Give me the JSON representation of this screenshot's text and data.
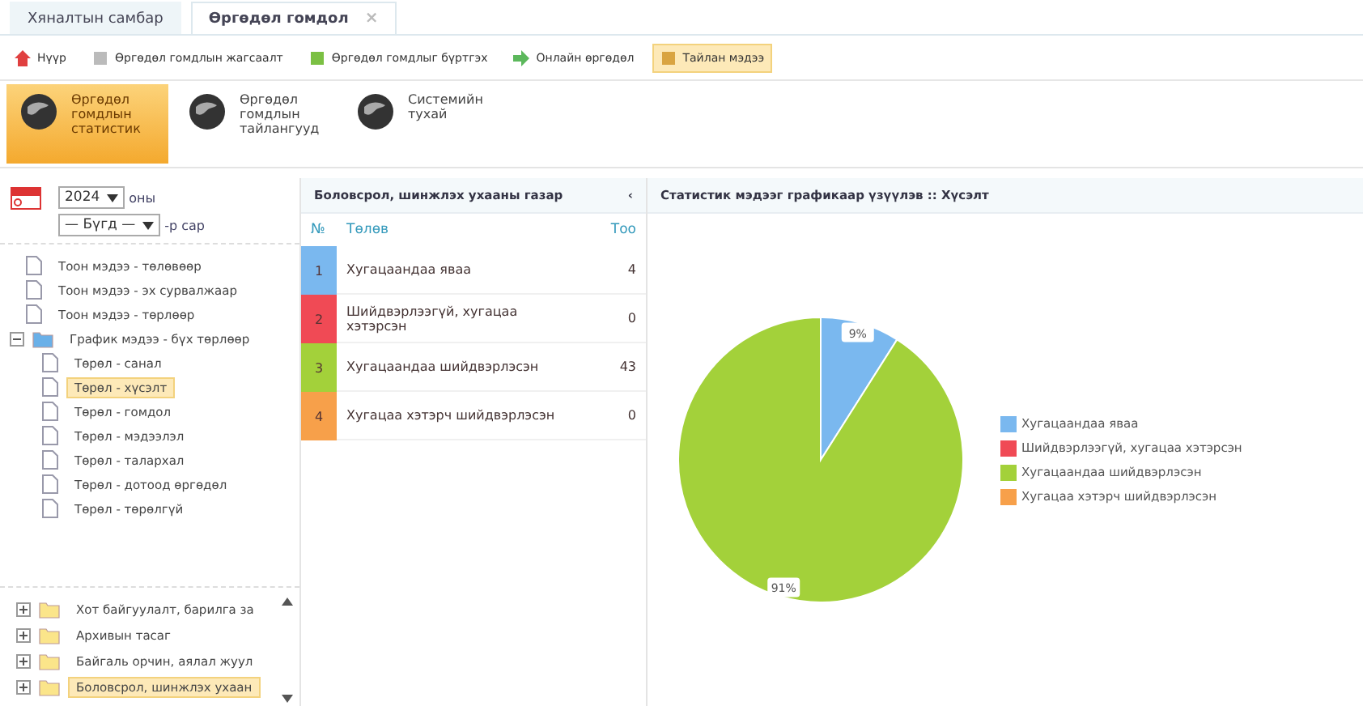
{
  "tabs": [
    {
      "label": "Хяналтын самбар",
      "selected": false,
      "closable": false
    },
    {
      "label": "Өргөдөл гомдол",
      "selected": true,
      "closable": true
    }
  ],
  "close_glyph": "×",
  "toolbar": [
    {
      "label": "Нүүр",
      "kind": "home",
      "selected": false
    },
    {
      "label": "Өргөдөл гомдлын жагсаалт",
      "kind": "list",
      "selected": false
    },
    {
      "label": "Өргөдөл гомдлыг бүртгэх",
      "kind": "add",
      "selected": false
    },
    {
      "label": "Онлайн өргөдөл",
      "kind": "online",
      "selected": false
    },
    {
      "label": "Тайлан мэдээ",
      "kind": "report",
      "selected": true
    }
  ],
  "modules": [
    {
      "label": "Өргөдөл гомдлын статистик",
      "selected": true
    },
    {
      "label": "Өргөдөл гомдлын тайлангууд",
      "selected": false
    },
    {
      "label": "Системийн тухай",
      "selected": false
    }
  ],
  "filters": {
    "year": "2024",
    "year_suffix": "оны",
    "month": "— Бүгд —",
    "month_suffix": "-р сар"
  },
  "report_tree": [
    {
      "label": "Тоон мэдээ - төлөвөөр",
      "selected": false
    },
    {
      "label": "Тоон мэдээ - эх сурвалжаар",
      "selected": false
    },
    {
      "label": "Тоон мэдээ - төрлөөр",
      "selected": false
    },
    {
      "label": "График мэдээ - бүх төрлөөр",
      "selected": false,
      "expanded": true,
      "children": [
        {
          "label": "Төрөл - санал",
          "selected": false
        },
        {
          "label": "Төрөл - хүсэлт",
          "selected": true
        },
        {
          "label": "Төрөл - гомдол",
          "selected": false
        },
        {
          "label": "Төрөл - мэдээлэл",
          "selected": false
        },
        {
          "label": "Төрөл - талархал",
          "selected": false
        },
        {
          "label": "Төрөл - дотоод өргөдөл",
          "selected": false
        },
        {
          "label": "Төрөл - төрөлгүй",
          "selected": false
        }
      ]
    }
  ],
  "org_tree": [
    {
      "label": "Хот байгуулалт, барилга за",
      "selected": false,
      "expanded": false
    },
    {
      "label": "Архивын тасаг",
      "selected": false,
      "expanded": false
    },
    {
      "label": "Байгаль орчин, аялал жуул",
      "selected": false,
      "expanded": false
    },
    {
      "label": "Боловсрол, шинжлэх ухаан",
      "selected": true,
      "expanded": false
    }
  ],
  "table": {
    "title": "Боловсрол, шинжлэх ухааны газар",
    "collapse_glyph": "‹",
    "columns": [
      "№",
      "Төлөв",
      "Тоо"
    ],
    "rows": [
      {
        "no": "1",
        "status": "Хугацаандаа яваа",
        "count": "4",
        "color": "#7ab8ef"
      },
      {
        "no": "2",
        "status": "Шийдвэрлээгүй, хугацаа хэтэрсэн",
        "count": "0",
        "color": "#f04a55"
      },
      {
        "no": "3",
        "status": "Хугацаандаа шийдвэрлэсэн",
        "count": "43",
        "color": "#a3d13a"
      },
      {
        "no": "4",
        "status": "Хугацаа хэтэрч шийдвэрлэсэн",
        "count": "0",
        "color": "#f7a04a"
      }
    ]
  },
  "chart_panel": {
    "title": "Статистик мэдээг графикаар үзүүлэв :: Хүсэлт",
    "chart_data": {
      "type": "pie",
      "categories": [
        "Хугацаандаа яваа",
        "Шийдвэрлээгүй, хугацаа хэтэрсэн",
        "Хугацаандаа шийдвэрлэсэн",
        "Хугацаа хэтэрч шийдвэрлэсэн"
      ],
      "series": [
        {
          "values": [
            9,
            0,
            91,
            0
          ]
        }
      ],
      "legend": true,
      "value_labels": [
        "9%",
        null,
        "91%",
        null
      ]
    }
  }
}
